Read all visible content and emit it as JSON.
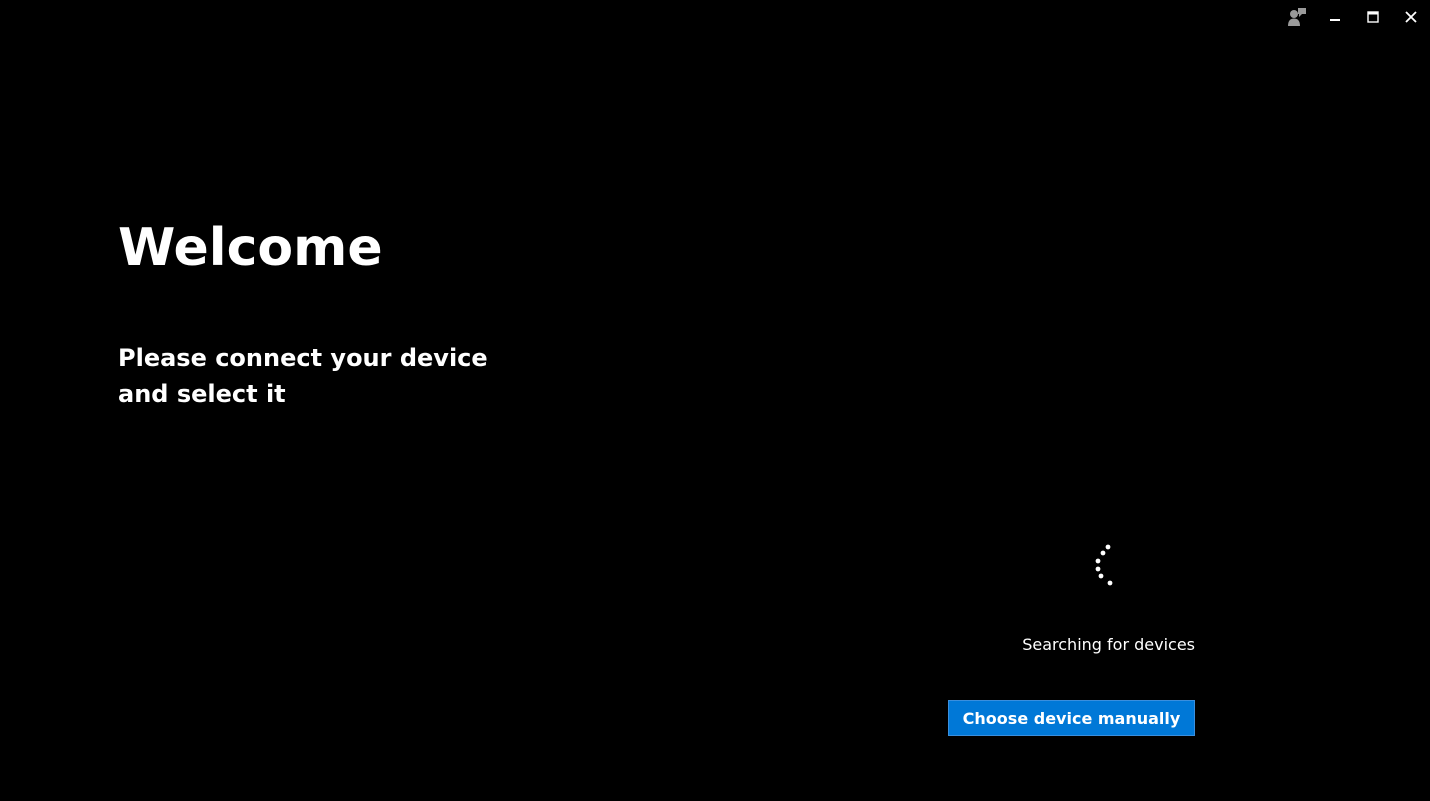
{
  "window_controls": {
    "feedback_icon": "feedback-person-icon",
    "minimize_icon": "minimize-icon",
    "maximize_icon": "maximize-icon",
    "close_icon": "close-icon"
  },
  "main": {
    "title": "Welcome",
    "subtitle": "Please connect your device and select it",
    "status": "Searching for devices",
    "choose_button_label": "Choose device manually"
  },
  "colors": {
    "background": "#000000",
    "text": "#ffffff",
    "accent": "#0078d7",
    "icon_gray": "#9a9a9a"
  }
}
